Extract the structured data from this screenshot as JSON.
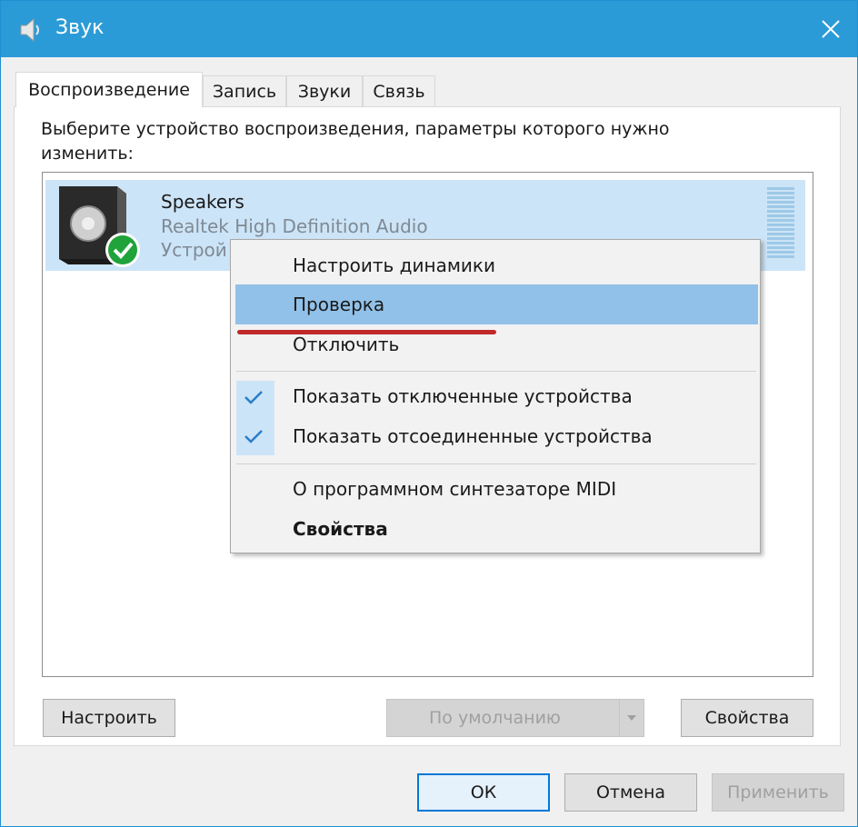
{
  "window": {
    "title": "Звук",
    "accent": "#2b9bd8"
  },
  "tabs": [
    {
      "label": "Воспроизведение",
      "active": true
    },
    {
      "label": "Запись",
      "active": false
    },
    {
      "label": "Звуки",
      "active": false
    },
    {
      "label": "Связь",
      "active": false
    }
  ],
  "instruction": "Выберите устройство воспроизведения, параметры которого нужно изменить:",
  "device": {
    "name": "Speakers",
    "driver": "Realtek High Definition Audio",
    "status": "Устрой",
    "selected": true,
    "default_badge_icon": "check-circle-icon"
  },
  "context_menu": {
    "items": [
      {
        "label": "Настроить динамики",
        "checked": false,
        "bold": false,
        "highlighted": false
      },
      {
        "label": "Проверка",
        "checked": false,
        "bold": false,
        "highlighted": true
      },
      {
        "label": "Отключить",
        "checked": false,
        "bold": false,
        "highlighted": false
      },
      {
        "label": "Показать отключенные устройства",
        "checked": true,
        "bold": false,
        "highlighted": false
      },
      {
        "label": "Показать отсоединенные устройства",
        "checked": true,
        "bold": false,
        "highlighted": false
      },
      {
        "label": "О программном синтезаторе MIDI",
        "checked": false,
        "bold": false,
        "highlighted": false
      },
      {
        "label": "Свойства",
        "checked": false,
        "bold": true,
        "highlighted": false
      }
    ],
    "highlight_color": "#91c1e8",
    "annotation_color": "#c0282a"
  },
  "buttons": {
    "configure": "Настроить",
    "set_default": "По умолчанию",
    "properties": "Свойства",
    "ok": "ОК",
    "cancel": "Отмена",
    "apply": "Применить"
  }
}
